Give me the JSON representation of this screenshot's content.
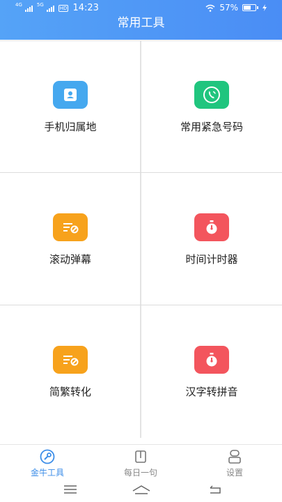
{
  "status_bar": {
    "network_1": "4G",
    "network_2": "5G",
    "hd": "HD",
    "time": "14:23",
    "battery": "57%"
  },
  "header": {
    "title": "常用工具"
  },
  "tools": [
    {
      "label": "手机归属地",
      "icon": "contact-card-icon",
      "color": "#45a8ef"
    },
    {
      "label": "常用紧急号码",
      "icon": "phone-call-icon",
      "color": "#20c57e"
    },
    {
      "label": "滚动弹幕",
      "icon": "barrage-text-icon",
      "color": "#f7a21c"
    },
    {
      "label": "时间计时器",
      "icon": "stopwatch-icon",
      "color": "#f3555d"
    },
    {
      "label": "简繁转化",
      "icon": "barrage-text-icon",
      "color": "#f7a21c"
    },
    {
      "label": "汉字转拼音",
      "icon": "stopwatch-icon",
      "color": "#f3555d"
    }
  ],
  "tabbar": {
    "tabs": [
      {
        "label": "金牛工具",
        "icon": "wrench-icon",
        "active": true
      },
      {
        "label": "每日一句",
        "icon": "book-icon",
        "active": false
      },
      {
        "label": "设置",
        "icon": "settings-icon",
        "active": false
      }
    ],
    "active_color": "#3d8ee8",
    "inactive_color": "#888888"
  }
}
